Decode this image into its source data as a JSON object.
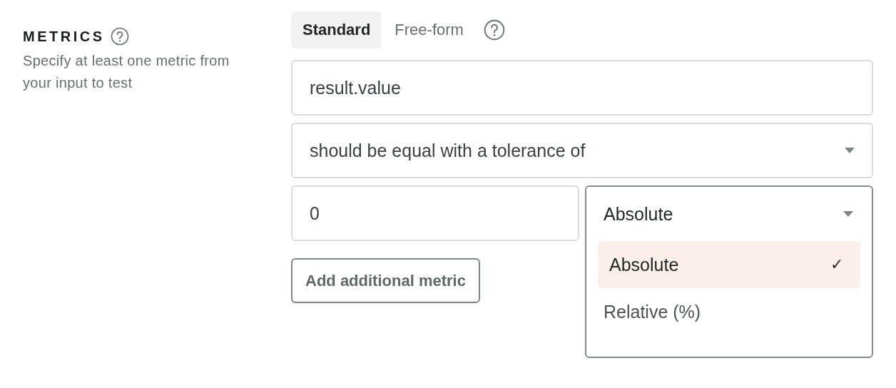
{
  "section": {
    "title": "METRICS",
    "description": "Specify at least one metric from your input to test"
  },
  "tabs": [
    {
      "label": "Standard",
      "selected": true
    },
    {
      "label": "Free-form",
      "selected": false
    }
  ],
  "metric_field": {
    "value": "result.value"
  },
  "comparison_select": {
    "value": "should be equal with a tolerance of"
  },
  "tolerance_field": {
    "value": "0"
  },
  "tolerance_type": {
    "value": "Absolute",
    "expanded": true,
    "options": [
      {
        "label": "Absolute",
        "selected": true,
        "check": "✓"
      },
      {
        "label": "Relative (%)",
        "selected": false
      }
    ]
  },
  "add_button": {
    "label": "Add additional metric"
  }
}
